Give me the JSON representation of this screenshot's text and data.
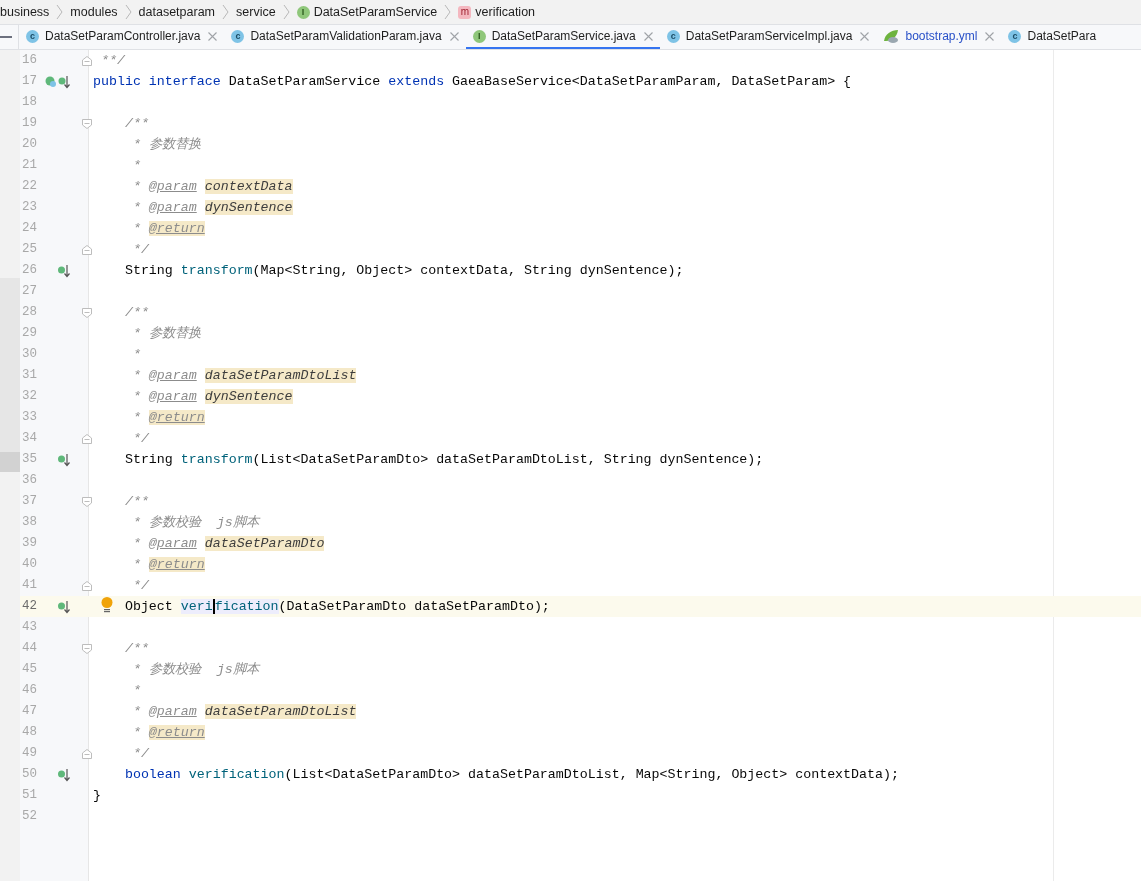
{
  "breadcrumbs": [
    {
      "label": "business"
    },
    {
      "label": "modules"
    },
    {
      "label": "datasetparam"
    },
    {
      "label": "service"
    },
    {
      "label": "DataSetParamService",
      "icon": {
        "kind": "interface",
        "letter": "I"
      }
    },
    {
      "label": "verification",
      "icon": {
        "kind": "method",
        "letter": "m"
      }
    }
  ],
  "tabs": [
    {
      "label": "DataSetParamController.java",
      "selected": false,
      "icon": {
        "kind": "class",
        "letter": "c"
      },
      "modified": false,
      "closable": true
    },
    {
      "label": "DataSetParamValidationParam.java",
      "selected": false,
      "icon": {
        "kind": "class",
        "letter": "c"
      },
      "modified": false,
      "closable": true
    },
    {
      "label": "DataSetParamService.java",
      "selected": true,
      "icon": {
        "kind": "interface",
        "letter": "I"
      },
      "modified": false,
      "closable": true
    },
    {
      "label": "DataSetParamServiceImpl.java",
      "selected": false,
      "icon": {
        "kind": "class",
        "letter": "c"
      },
      "modified": false,
      "closable": true
    },
    {
      "label": "bootstrap.yml",
      "selected": false,
      "icon": {
        "kind": "spring"
      },
      "modified": true,
      "closable": true
    },
    {
      "label": "DataSetPara",
      "selected": false,
      "icon": {
        "kind": "class",
        "letter": "c"
      },
      "modified": false,
      "closable": false
    }
  ],
  "editor": {
    "lines": [
      {
        "number": "16",
        "current": false,
        "fold_end": true,
        "segments": [
          {
            "kind": "comment",
            "text": " **/"
          }
        ]
      },
      {
        "number": "17",
        "current": false,
        "implemented": true,
        "overridden": true,
        "segments": [
          {
            "kind": "keyword",
            "text": "public "
          },
          {
            "kind": "keyword",
            "text": "interface"
          },
          {
            "kind": "plain",
            "text": " DataSetParamService "
          },
          {
            "kind": "keyword",
            "text": "extends"
          },
          {
            "kind": "plain",
            "text": " GaeaBaseService<DataSetParamParam, DataSetParam> {"
          }
        ]
      },
      {
        "number": "18",
        "current": false
      },
      {
        "number": "19",
        "current": false,
        "fold_start": true,
        "segments": [
          {
            "kind": "comment",
            "text": "    /**"
          }
        ]
      },
      {
        "number": "20",
        "current": false,
        "segments": [
          {
            "kind": "comment",
            "text": "     * 参数替换"
          }
        ]
      },
      {
        "number": "21",
        "current": false,
        "segments": [
          {
            "kind": "comment",
            "text": "     *"
          }
        ]
      },
      {
        "number": "22",
        "current": false,
        "segments": [
          {
            "kind": "comment",
            "text": "     * "
          },
          {
            "kind": "doctag",
            "text": "@param"
          },
          {
            "kind": "docvalue",
            "text": "contextData",
            "highlighted": true
          }
        ]
      },
      {
        "number": "23",
        "current": false,
        "segments": [
          {
            "kind": "comment",
            "text": "     * "
          },
          {
            "kind": "doctag",
            "text": "@param"
          },
          {
            "kind": "docvalue",
            "text": "dynSentence",
            "highlighted": true
          }
        ]
      },
      {
        "number": "24",
        "current": false,
        "segments": [
          {
            "kind": "comment",
            "text": "     * "
          },
          {
            "kind": "doctag",
            "text": "@return",
            "highlighted": true
          }
        ]
      },
      {
        "number": "25",
        "current": false,
        "fold_end": true,
        "segments": [
          {
            "kind": "comment",
            "text": "     */"
          }
        ]
      },
      {
        "number": "26",
        "current": false,
        "implemented": true,
        "overridden": false,
        "segments": [
          {
            "kind": "plain",
            "text": "    String "
          },
          {
            "kind": "method",
            "text": "transform"
          },
          {
            "kind": "plain",
            "text": "(Map<String, Object> contextData, String dynSentence);"
          }
        ]
      },
      {
        "number": "27",
        "current": false
      },
      {
        "number": "28",
        "current": false,
        "fold_start": true,
        "segments": [
          {
            "kind": "comment",
            "text": "    /**"
          }
        ]
      },
      {
        "number": "29",
        "current": false,
        "segments": [
          {
            "kind": "comment",
            "text": "     * 参数替换"
          }
        ]
      },
      {
        "number": "30",
        "current": false,
        "segments": [
          {
            "kind": "comment",
            "text": "     *"
          }
        ]
      },
      {
        "number": "31",
        "current": false,
        "segments": [
          {
            "kind": "comment",
            "text": "     * "
          },
          {
            "kind": "doctag",
            "text": "@param"
          },
          {
            "kind": "docvalue",
            "text": "dataSetParamDtoList",
            "highlighted": true
          }
        ]
      },
      {
        "number": "32",
        "current": false,
        "segments": [
          {
            "kind": "comment",
            "text": "     * "
          },
          {
            "kind": "doctag",
            "text": "@param"
          },
          {
            "kind": "docvalue",
            "text": "dynSentence",
            "highlighted": true
          }
        ]
      },
      {
        "number": "33",
        "current": false,
        "segments": [
          {
            "kind": "comment",
            "text": "     * "
          },
          {
            "kind": "doctag",
            "text": "@return",
            "highlighted": true
          }
        ]
      },
      {
        "number": "34",
        "current": false,
        "fold_end": true,
        "segments": [
          {
            "kind": "comment",
            "text": "     */"
          }
        ]
      },
      {
        "number": "35",
        "current": false,
        "implemented": true,
        "overridden": false,
        "segments": [
          {
            "kind": "plain",
            "text": "    String "
          },
          {
            "kind": "method",
            "text": "transform"
          },
          {
            "kind": "plain",
            "text": "(List<DataSetParamDto> dataSetParamDtoList, String dynSentence);"
          }
        ]
      },
      {
        "number": "36",
        "current": false
      },
      {
        "number": "37",
        "current": false,
        "fold_start": true,
        "segments": [
          {
            "kind": "comment",
            "text": "    /**"
          }
        ]
      },
      {
        "number": "38",
        "current": false,
        "segments": [
          {
            "kind": "comment",
            "text": "     * 参数校验  js脚本"
          }
        ]
      },
      {
        "number": "39",
        "current": false,
        "segments": [
          {
            "kind": "comment",
            "text": "     * "
          },
          {
            "kind": "doctag",
            "text": "@param"
          },
          {
            "kind": "docvalue",
            "text": "dataSetParamDto",
            "highlighted": true
          }
        ]
      },
      {
        "number": "40",
        "current": false,
        "segments": [
          {
            "kind": "comment",
            "text": "     * "
          },
          {
            "kind": "doctag",
            "text": "@return",
            "highlighted": true
          }
        ]
      },
      {
        "number": "41",
        "current": false,
        "fold_end": true,
        "segments": [
          {
            "kind": "comment",
            "text": "     */"
          }
        ]
      },
      {
        "number": "42",
        "current": true,
        "bulb": true,
        "implemented": true,
        "overridden": false,
        "segments": [
          {
            "kind": "plain",
            "text": "    Object "
          },
          {
            "kind": "method",
            "text": "veri",
            "highlighted": true
          },
          {
            "kind": "method",
            "text": "fication",
            "highlighted": true,
            "caret_before": true
          },
          {
            "kind": "plain",
            "text": "(DataSetParamDto dataSetParamDto);"
          }
        ]
      },
      {
        "number": "43",
        "current": false
      },
      {
        "number": "44",
        "current": false,
        "fold_start": true,
        "segments": [
          {
            "kind": "comment",
            "text": "    /**"
          }
        ]
      },
      {
        "number": "45",
        "current": false,
        "segments": [
          {
            "kind": "comment",
            "text": "     * 参数校验  js脚本"
          }
        ]
      },
      {
        "number": "46",
        "current": false,
        "segments": [
          {
            "kind": "comment",
            "text": "     *"
          }
        ]
      },
      {
        "number": "47",
        "current": false,
        "segments": [
          {
            "kind": "comment",
            "text": "     * "
          },
          {
            "kind": "doctag",
            "text": "@param"
          },
          {
            "kind": "docvalue",
            "text": "dataSetParamDtoList",
            "highlighted": true
          }
        ]
      },
      {
        "number": "48",
        "current": false,
        "segments": [
          {
            "kind": "comment",
            "text": "     * "
          },
          {
            "kind": "doctag",
            "text": "@return",
            "highlighted": true
          }
        ]
      },
      {
        "number": "49",
        "current": false,
        "fold_end": true,
        "segments": [
          {
            "kind": "comment",
            "text": "     */"
          }
        ]
      },
      {
        "number": "50",
        "current": false,
        "implemented": true,
        "overridden": false,
        "segments": [
          {
            "kind": "keyword",
            "text": "    boolean "
          },
          {
            "kind": "method",
            "text": "verification"
          },
          {
            "kind": "plain",
            "text": "(List<DataSetParamDto> dataSetParamDtoList, Map<String, Object> contextData);"
          }
        ]
      },
      {
        "number": "51",
        "current": false,
        "segments": [
          {
            "kind": "plain",
            "text": "}"
          }
        ]
      },
      {
        "number": "52",
        "current": false
      }
    ]
  }
}
